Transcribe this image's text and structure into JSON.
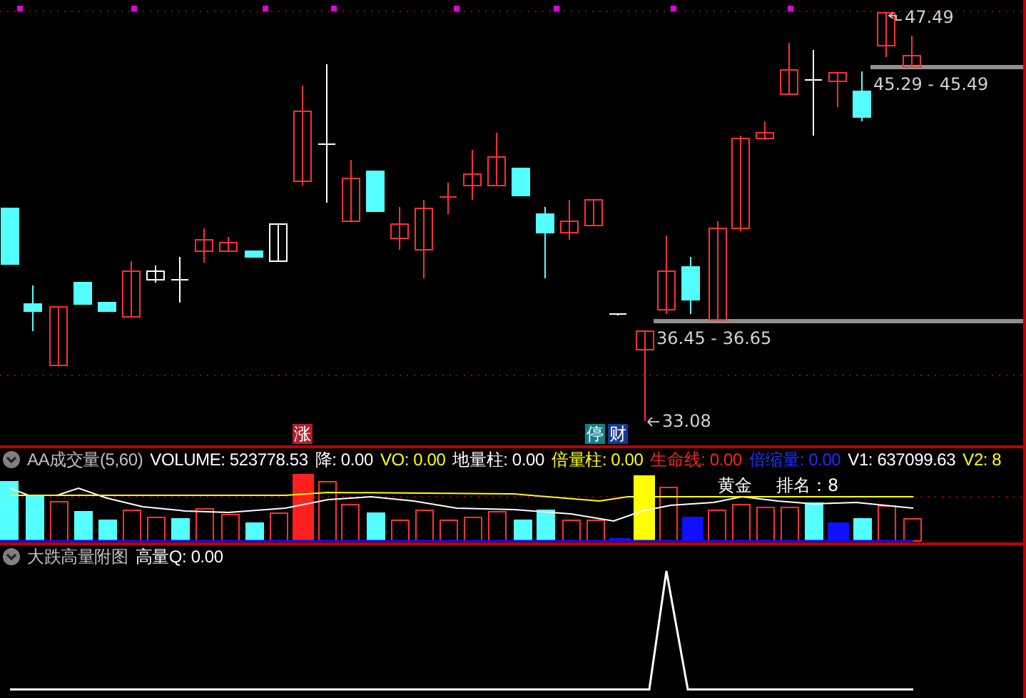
{
  "price_panel": {
    "price_labels": [
      {
        "text": "47.49",
        "kind": "high"
      },
      {
        "text": "45.29 - 45.49",
        "kind": "range"
      },
      {
        "text": "36.45 - 36.65",
        "kind": "range"
      },
      {
        "text": "33.08",
        "kind": "low"
      }
    ],
    "badges": [
      {
        "text": "涨",
        "color": "#b0202a"
      },
      {
        "text": "停",
        "color": "#14808c"
      },
      {
        "text": "财",
        "color": "#1a3a8c"
      }
    ]
  },
  "volume_header": {
    "items": [
      {
        "text": "AA成交量(5,60)",
        "color": "#c0c0c0"
      },
      {
        "text": "VOLUME: 523778.53",
        "color": "#ffffff"
      },
      {
        "text": "降: 0.00",
        "color": "#ffffff"
      },
      {
        "text": "VO: 0.00",
        "color": "#ffff00"
      },
      {
        "text": "地量柱: 0.00",
        "color": "#ffffff"
      },
      {
        "text": "倍量柱: 0.00",
        "color": "#ffff00"
      },
      {
        "text": "生命线: 0.00",
        "color": "#ff2020"
      },
      {
        "text": "倍缩量: 0.00",
        "color": "#2030ff"
      },
      {
        "text": "V1: 637099.63",
        "color": "#ffffff"
      },
      {
        "text": "V2: 8",
        "color": "#ffff00"
      }
    ]
  },
  "volume_panel": {
    "gold_label": "黄金",
    "rank_label": "排名：8"
  },
  "sub_header": {
    "items": [
      {
        "text": "大跌高量附图",
        "color": "#c0c0c0"
      },
      {
        "text": "高量Q: 0.00",
        "color": "#ffffff"
      }
    ]
  }
}
